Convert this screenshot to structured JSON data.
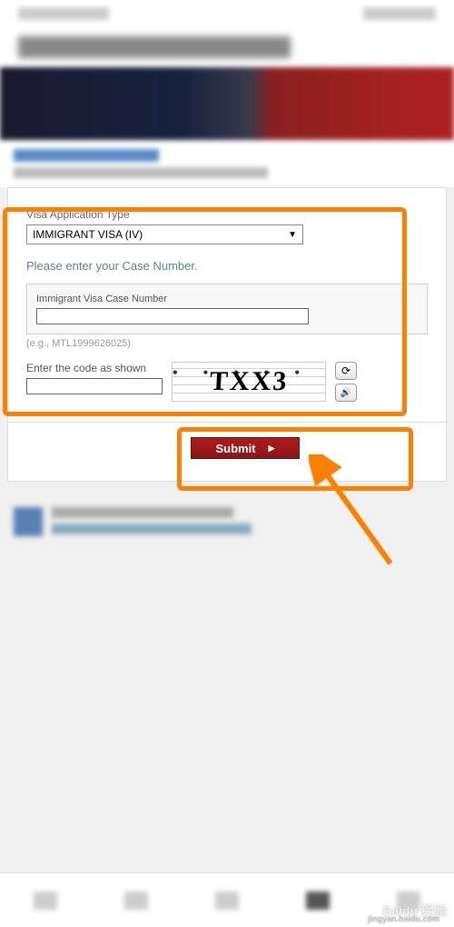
{
  "form": {
    "visa_type_label": "Visa Application Type",
    "visa_type_value": "IMMIGRANT VISA (IV)",
    "instruction": "Please enter your Case Number.",
    "case_label": "Immigrant Visa Case Number",
    "case_value": "",
    "case_hint": "(e.g., MTL1999626025)",
    "captcha_label": "Enter the code as shown",
    "captcha_value": "",
    "captcha_image_text": "TXX3"
  },
  "buttons": {
    "submit": "Submit",
    "refresh_icon": "⟳",
    "audio_icon": "🔊"
  },
  "watermark": {
    "main": "Baidu 经验",
    "sub": "jingyan.baidu.com"
  },
  "colors": {
    "highlight": "#ff7f00",
    "submit_bg": "#a01818",
    "link": "#5a7fa8"
  }
}
